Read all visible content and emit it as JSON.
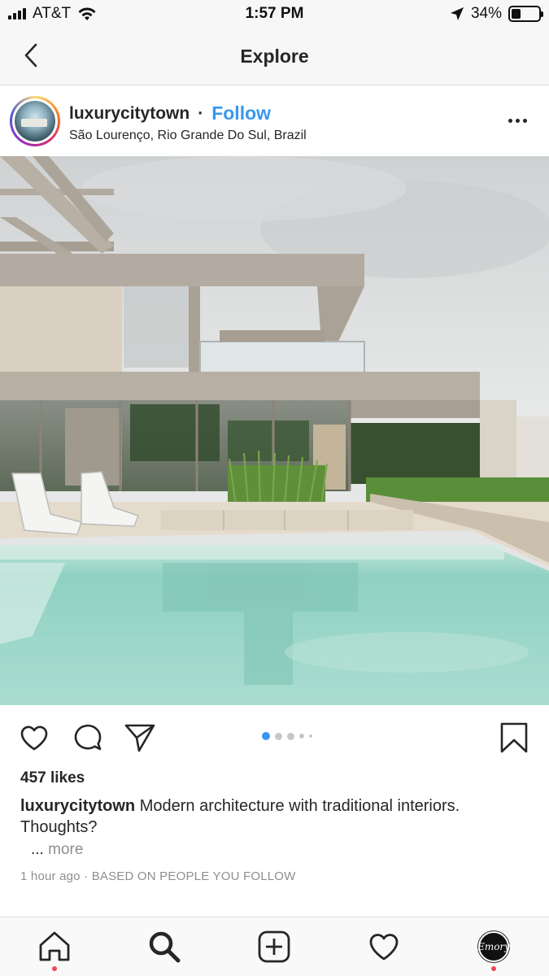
{
  "status_bar": {
    "carrier": "AT&T",
    "time": "1:57 PM",
    "battery": "34%",
    "battery_level": 0.34
  },
  "nav": {
    "title": "Explore",
    "back_icon": "chevron-left-icon"
  },
  "post": {
    "username": "luxurycitytown",
    "separator": "·",
    "follow_label": "Follow",
    "location": "São Lourenço, Rio Grande Do Sul, Brazil",
    "more_icon": "ellipsis-icon",
    "carousel": {
      "total": 5,
      "current": 1
    },
    "likes": "457 likes",
    "caption_user": "luxurycitytown",
    "caption_text": "Modern architecture with traditional interiors. Thoughts?",
    "more_ellipsis": "...",
    "more_label": "more",
    "timestamp": "1 hour ago",
    "meta_separator": "·",
    "reason": "BASED ON PEOPLE YOU FOLLOW",
    "actions": [
      "heart-icon",
      "comment-icon",
      "share-icon",
      "bookmark-icon"
    ]
  },
  "tabbar": {
    "items": [
      "home-icon",
      "search-icon",
      "add-icon",
      "activity-icon",
      "profile-avatar"
    ],
    "profile_initials": "Emory",
    "accent": "#ed4956"
  },
  "colors": {
    "link_blue": "#3897f0",
    "text": "#262626",
    "muted": "#8e8e8e"
  }
}
